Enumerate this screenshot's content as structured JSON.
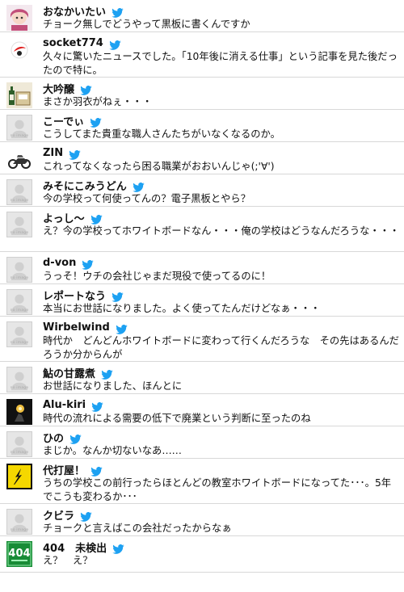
{
  "noimage_label": "no image",
  "tweets": [
    {
      "name": "おなかいたい",
      "text": "チョーク無しでどうやって黒板に書くんですか",
      "avatar": "doll-avatar"
    },
    {
      "name": "socket774",
      "text": "久々に驚いたニュースでした。「10年後に消える仕事」という記事を見た後だったので特に。",
      "avatar": "logo-avatar"
    },
    {
      "name": "大吟醸",
      "text": "まさか羽衣がねぇ・・・",
      "avatar": "sake-avatar"
    },
    {
      "name": "こーでぃ",
      "text": "こうしてまた貴重な職人さんたちがいなくなるのか。",
      "avatar": "noimage"
    },
    {
      "name": "ZIN",
      "text": "これってなくなったら困る職業がおおいんじゃ(;'∀')",
      "avatar": "motorcycle-avatar"
    },
    {
      "name": "みそにこみうどん",
      "text": "今の学校って何使ってんの？電子黒板とやら？",
      "avatar": "noimage"
    },
    {
      "name": "よっし～",
      "text": "え？今の学校ってホワイトボードなん・・・俺の学校はどうなんだろうな・・・",
      "avatar": "noimage"
    },
    {
      "name": "d-von",
      "text": "うっそ！ウチの会社じゃまだ現役で使ってるのに！",
      "avatar": "noimage"
    },
    {
      "name": "レポートなう",
      "text": "本当にお世話になりました。よく使ってたんだけどなぁ・・・",
      "avatar": "noimage"
    },
    {
      "name": "Wirbelwind",
      "text": "時代か　どんどんホワイトボードに変わって行くんだろうな　その先はあるんだろうか分からんが",
      "avatar": "noimage"
    },
    {
      "name": "鮎の甘露煮",
      "text": "お世話になりました、ほんとに",
      "avatar": "noimage"
    },
    {
      "name": "Alu-kiri",
      "text": "時代の流れによる需要の低下で廃業という判断に至ったのね",
      "avatar": "dark-avatar"
    },
    {
      "name": "ひの",
      "text": "まじか。なんか切ないなあ……",
      "avatar": "noimage"
    },
    {
      "name": "代打屋！",
      "text": "うちの学校この前行ったらほとんどの教室ホワイトボードになってた･･･。5年でこうも変わるか･･･",
      "avatar": "warning-avatar"
    },
    {
      "name": "クビラ",
      "text": "チョークと言えばこの会社だったからなぁ",
      "avatar": "noimage"
    },
    {
      "name": "404　未検出",
      "text": "え？　え？",
      "avatar": "404-avatar",
      "avatar_text": "404"
    }
  ]
}
